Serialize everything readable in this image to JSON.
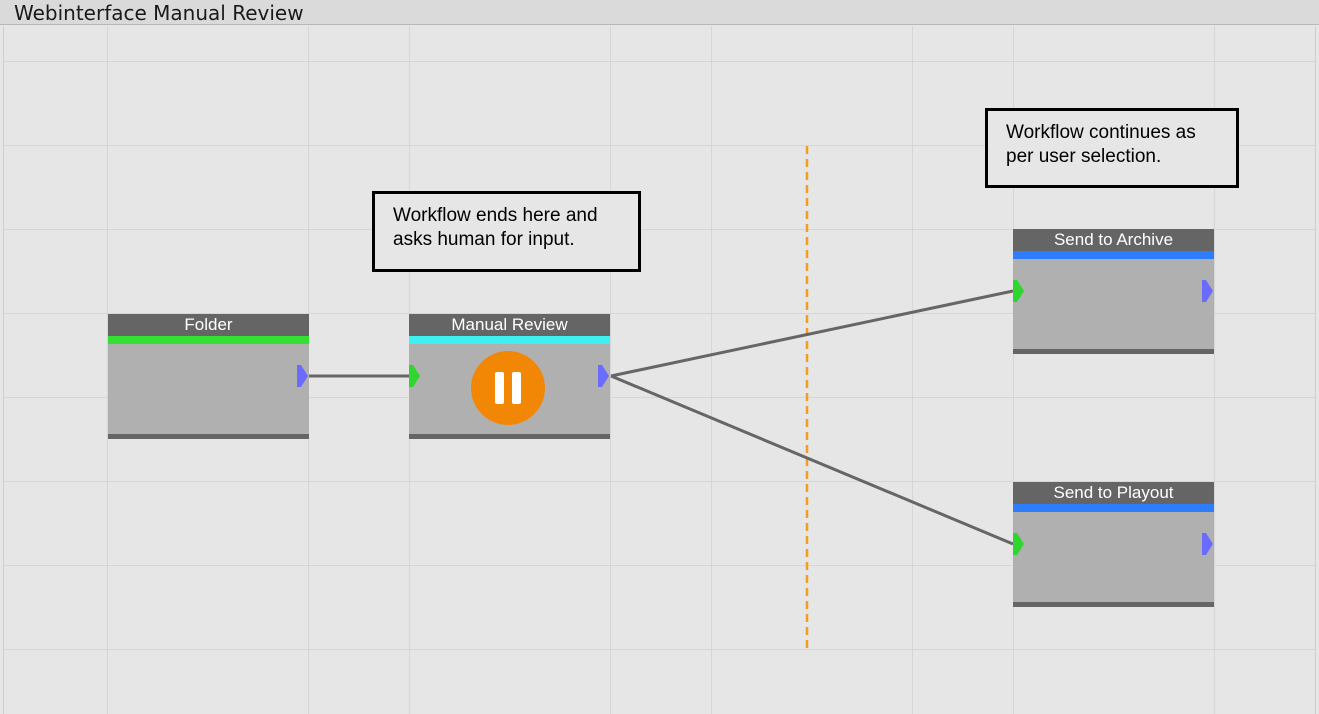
{
  "window": {
    "title": "Webinterface Manual Review"
  },
  "nodes": {
    "folder": {
      "label": "Folder",
      "stripe_color": "#33e033"
    },
    "manual_review": {
      "label": "Manual Review",
      "stripe_color": "#3ff0f0",
      "status_icon": "pause-icon",
      "status_color": "#f28706"
    },
    "send_to_archive": {
      "label": "Send to Archive",
      "stripe_color": "#2f7dff"
    },
    "send_to_playout": {
      "label": "Send to Playout",
      "stripe_color": "#2f7dff"
    }
  },
  "notes": {
    "workflow_ends": "Workflow ends here and asks human for input.",
    "workflow_continues": "Workflow continues as per user selection."
  },
  "colors": {
    "input_port": "#2fd62f",
    "output_port": "#6b6bff",
    "connection": "#666666",
    "separator": "#f0a020"
  },
  "connections": [
    {
      "from": "folder",
      "to": "manual_review"
    },
    {
      "from": "manual_review",
      "to": "send_to_archive"
    },
    {
      "from": "manual_review",
      "to": "send_to_playout"
    }
  ]
}
